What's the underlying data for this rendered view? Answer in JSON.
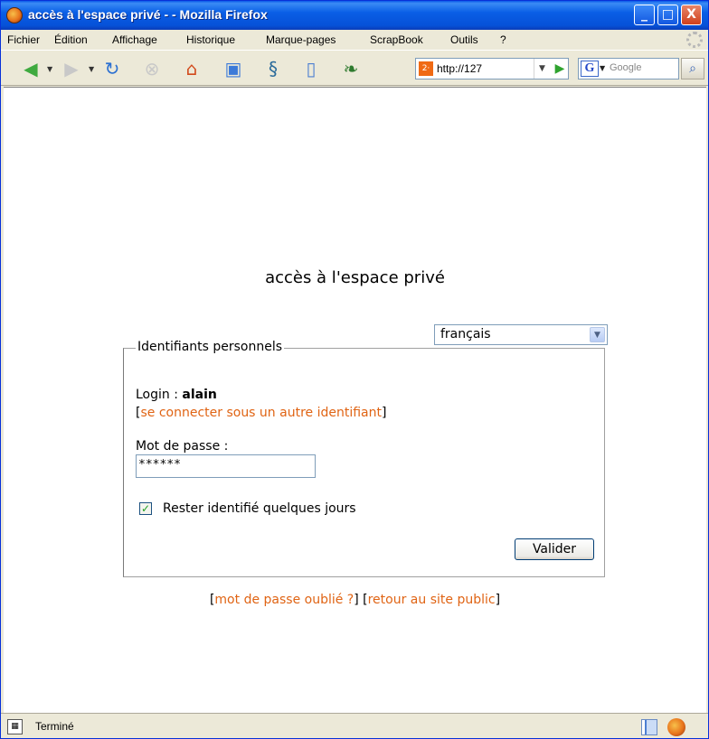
{
  "window": {
    "title": "accès à l'espace privé - - Mozilla Firefox",
    "minimize": "_",
    "maximize": "□",
    "close": "X"
  },
  "menubar": {
    "items": [
      {
        "label": "Fichier"
      },
      {
        "label": "Édition"
      },
      {
        "label": "Affichage"
      },
      {
        "label": "Historique"
      },
      {
        "label": "Marque-pages"
      },
      {
        "label": "ScrapBook"
      },
      {
        "label": "Outils"
      },
      {
        "label": "?"
      }
    ]
  },
  "toolbar": {
    "icons": [
      "back-arrow-icon",
      "forward-arrow-icon",
      "reload-icon",
      "stop-icon",
      "home-icon",
      "bookmarks-icon",
      "seahorse-icon",
      "sidebar-icon",
      "leaf-icon"
    ],
    "url": "http://127",
    "search_engine": "G",
    "search_placeholder": "Google"
  },
  "page": {
    "title": "accès à l'espace privé",
    "language_select": {
      "selected": "français"
    },
    "fieldset_legend": "Identifiants personnels",
    "login_label": "Login : ",
    "login_value": "alain",
    "other_id_open": "[",
    "other_id_link": "se connecter sous un autre identifiant",
    "other_id_close": "]",
    "password_label": "Mot de passe :",
    "password_value": "******",
    "remember_checked": true,
    "remember_label": "Rester identifié quelques jours",
    "submit_label": "Valider",
    "footer": {
      "open1": "[",
      "forgot_link": "mot de passe oublié ?",
      "close1": "] [",
      "public_link": "retour au site public",
      "close2": "]"
    }
  },
  "statusbar": {
    "text": "Terminé"
  },
  "colors": {
    "link": "#e06414",
    "titlebar": "#0a5fe6"
  }
}
